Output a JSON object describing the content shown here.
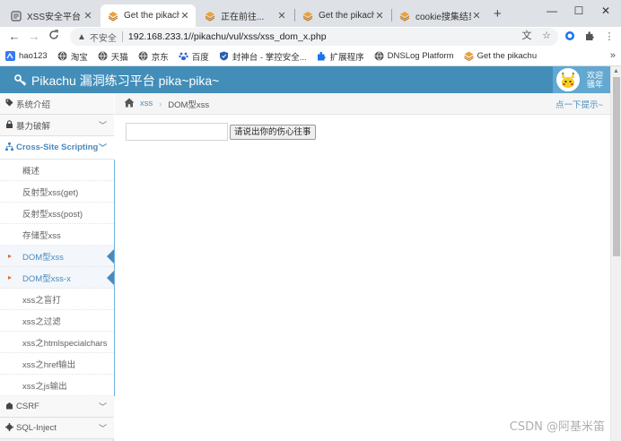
{
  "tabs": [
    {
      "title": "XSS安全平台",
      "active": false
    },
    {
      "title": "Get the pikachu",
      "active": true
    },
    {
      "title": "正在前往...",
      "active": false
    },
    {
      "title": "Get the pikachu",
      "active": false
    },
    {
      "title": "cookie搜集结果",
      "active": false
    }
  ],
  "window": {
    "minimize": "—",
    "maximize": "☐",
    "close": "✕",
    "new_tab": "+"
  },
  "toolbar": {
    "back": "←",
    "forward": "→",
    "reload": "C",
    "security_label": "不安全",
    "url": "192.168.233.1//pikachu/vul/xss/xss_dom_x.php"
  },
  "bookmarks": [
    {
      "label": "hao123",
      "color": "#3478f6"
    },
    {
      "label": "淘宝",
      "color": "#555555"
    },
    {
      "label": "天猫",
      "color": "#555555"
    },
    {
      "label": "京东",
      "color": "#555555"
    },
    {
      "label": "百度",
      "color": "#3365d4"
    },
    {
      "label": "封神台 - 掌控安全...",
      "color": "#2b5cb8"
    },
    {
      "label": "扩展程序",
      "color": "#1a73e8"
    },
    {
      "label": "DNSLog Platform",
      "color": "#555555"
    },
    {
      "label": "Get the pikachu",
      "color": "#c98a2c"
    }
  ],
  "bookmarks_more": "»",
  "header": {
    "brand": "Pikachu 漏洞练习平台 pika~pika~",
    "welcome_line1": "欢迎",
    "welcome_line2": "骚年"
  },
  "sidebar": {
    "top_items": [
      {
        "label": "系统介绍",
        "icon": "tag-icon"
      },
      {
        "label": "暴力破解",
        "icon": "lock-icon"
      }
    ],
    "open_section": {
      "label": "Cross-Site Scripting",
      "icon": "sitemap-icon"
    },
    "sub_items": [
      {
        "label": "概述",
        "active": false
      },
      {
        "label": "反射型xss(get)",
        "active": false
      },
      {
        "label": "反射型xss(post)",
        "active": false
      },
      {
        "label": "存储型xss",
        "active": false
      },
      {
        "label": "DOM型xss",
        "active": true
      },
      {
        "label": "DOM型xss-x",
        "active": true
      },
      {
        "label": "xss之盲打",
        "active": false
      },
      {
        "label": "xss之过滤",
        "active": false
      },
      {
        "label": "xss之htmlspecialchars",
        "active": false
      },
      {
        "label": "xss之href输出",
        "active": false
      },
      {
        "label": "xss之js输出",
        "active": false
      }
    ],
    "bottom_items": [
      {
        "label": "CSRF",
        "icon": "cloud-icon"
      },
      {
        "label": "SQL-Inject",
        "icon": "gear-icon"
      }
    ]
  },
  "breadcrumb": {
    "link": "xss",
    "current": "DOM型xss",
    "hint": "点一下提示~"
  },
  "form": {
    "input_value": "",
    "button_label": "请说出你的伤心往事"
  },
  "watermark": "CSDN @阿基米笛",
  "colors": {
    "navbar": "#438eb9",
    "accent": "#4a89bd",
    "tabbar": "#dee1e6"
  }
}
